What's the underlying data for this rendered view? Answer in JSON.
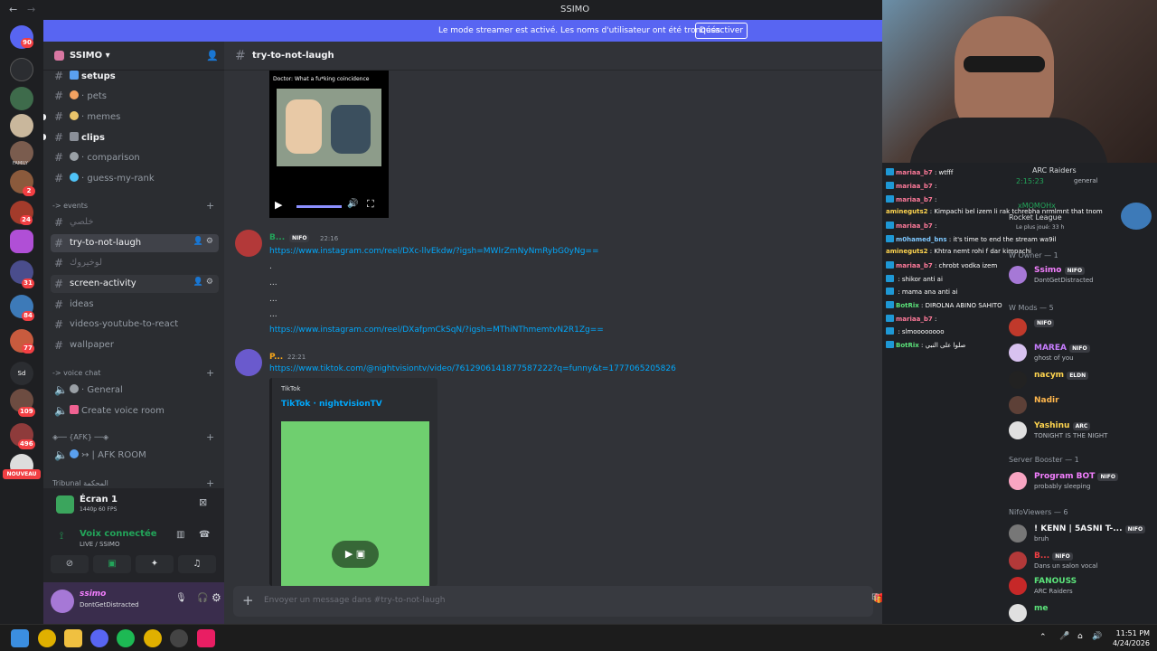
{
  "titlebar": {
    "back": "←",
    "forward": "→",
    "title": "SSIMO"
  },
  "banner": {
    "text": "Le mode streamer est activé. Les noms d'utilisateur ont été tronqués.",
    "button": "Désactiver"
  },
  "rail": {
    "badges": [
      "90",
      "2",
      "24",
      "31",
      "84",
      "77",
      "109",
      "496"
    ],
    "family_label": "FAMILY",
    "nouveau": "NOUVEAU"
  },
  "guild": {
    "name": "SSIMO"
  },
  "channels": [
    {
      "label": "setups",
      "bold": true,
      "hash": "#"
    },
    {
      "label": "· pets",
      "hash": "#"
    },
    {
      "label": "· memes",
      "hash": "#"
    },
    {
      "label": "clips",
      "bold": true,
      "hash": "#"
    },
    {
      "label": "· comparison",
      "hash": "#"
    },
    {
      "label": "· guess-my-rank",
      "hash": "#"
    }
  ],
  "categories": {
    "events": "-> events",
    "voice": "-> voice chat",
    "afk": "◈── {AFK} ──◈",
    "tribunal": "Tribunal المحكمة"
  },
  "events_channels": [
    {
      "label": "خلصي"
    },
    {
      "label": "try-to-not-laugh"
    },
    {
      "label": "لوخيروك"
    },
    {
      "label": "screen-activity"
    },
    {
      "label": "ideas"
    },
    {
      "label": "videos-youtube-to-react"
    },
    {
      "label": "wallpaper"
    }
  ],
  "voice_channels": [
    {
      "label": "· General"
    },
    {
      "label": "Create voice room"
    },
    {
      "label": "↣ | AFK ROOM"
    }
  ],
  "screen_share": {
    "title": "Écran 1",
    "quality": "1440p 60 FPS"
  },
  "voice": {
    "status": "Voix connectée",
    "sub": "LIVE / SSIMO"
  },
  "user": {
    "name": "ssimo",
    "status": "DontGetDistracted"
  },
  "chat": {
    "channel": "try-to-not-laugh",
    "meme_caption": "Doctor: What a fu*king coincidence",
    "messages": [
      {
        "author": "B...",
        "tag": "NIFO",
        "time": "22:16",
        "lines": [
          "https://www.instagram.com/reel/DXc-llvEkdw/?igsh=MWlrZmNyNmRybG0yNg==",
          ".",
          "...",
          "...",
          "...",
          "https://www.instagram.com/reel/DXafpmCkSqN/?igsh=MThiNThmemtvN2R1Zg=="
        ]
      },
      {
        "author": "P...",
        "time": "22:21",
        "lines": [
          "https://www.tiktok.com/@nightvisiontv/video/7612906141877587222?q=funny&t=1777065205826"
        ],
        "embed_provider": "TikTok",
        "embed_title": "TikTok · nightvisionTV"
      }
    ],
    "placeholder": "Envoyer un message dans #try-to-not-laugh"
  },
  "overlay": {
    "chat_lines": [
      {
        "user": "mariaa_b7",
        "text": ": wtfff",
        "color": "#ff7a9a"
      },
      {
        "user": "mariaa_b7",
        "text": ":",
        "color": "#ff7a9a"
      },
      {
        "user": "mariaa_b7",
        "text": ":",
        "color": "#ff7a9a"
      },
      {
        "user": "amineguts2",
        "text": ": Kimpachi bel izem li rak tchrebha nrmlmnt that tnom",
        "color": "#ffd54f"
      },
      {
        "user": "mariaa_b7",
        "text": ":",
        "color": "#ff7a9a"
      },
      {
        "user": "m0hamed_bns",
        "text": ": it's time to end the stream wa9il",
        "color": "#7ec8ff"
      },
      {
        "user": "amineguts2",
        "text": ": Khtra nemt rohi f dar kimpachi",
        "color": "#ffd54f"
      },
      {
        "user": "mariaa_b7",
        "text": ": chrobt vodka izem",
        "color": "#ff7a9a"
      },
      {
        "user": "",
        "text": ": shikor anti ai",
        "color": "#f23f43"
      },
      {
        "user": "",
        "text": ": mama ana anti ai",
        "color": "#f23f43"
      },
      {
        "user": "BotRix",
        "text": ": DIROLNA ABINO SAHITO",
        "color": "#5be37a"
      },
      {
        "user": "mariaa_b7",
        "text": ":",
        "color": "#ff7a9a"
      },
      {
        "user": "",
        "text": ": slmoooooooo",
        "color": "#f23f43"
      },
      {
        "user": "BotRix",
        "text": ": صلوا على النبي",
        "color": "#5be37a"
      }
    ],
    "activity": {
      "title": "ARC Raiders",
      "time": "2:15:23",
      "channel": "general"
    },
    "rl": {
      "user": "xMOMOHx",
      "game": "Rocket League",
      "played": "Le plus joué: 33 h"
    },
    "sections": {
      "owner": "W Owner — 1",
      "mods": "W Mods — 5",
      "booster": "Server Booster — 1",
      "viewers": "NifoViewers — 6"
    },
    "members": [
      {
        "name": "Ssimo",
        "tag": "NIFO",
        "status": "DontGetDistracted",
        "color": "#f47fff"
      },
      {
        "name": "",
        "tag": "NIFO",
        "status": "",
        "color": "#f23f43"
      },
      {
        "name": "MAREA",
        "tag": "NIFO",
        "status": "ghost of you",
        "color": "#c77dff"
      },
      {
        "name": "nacym",
        "tag": "ELDN",
        "status": "",
        "color": "#ffd54f"
      },
      {
        "name": "Nadir",
        "tag": "",
        "status": "",
        "color": "#ffb74d"
      },
      {
        "name": "Yashinu",
        "tag": "ARC",
        "status": "TONIGHT IS THE NIGHT",
        "color": "#ffd54f"
      },
      {
        "name": "Program BOT",
        "tag": "NIFO",
        "status": "probably sleeping",
        "color": "#f47fff"
      },
      {
        "name": "! KENN | 5ASNI T-...",
        "tag": "NIFO",
        "status": "bruh",
        "color": "#f2f3f5"
      },
      {
        "name": "B...",
        "tag": "NIFO",
        "status": "Dans un salon vocal",
        "color": "#f23f43"
      },
      {
        "name": "FANOUSS",
        "tag": "",
        "status": "ARC Raiders",
        "color": "#5be37a"
      },
      {
        "name": "me",
        "tag": "",
        "status": "",
        "color": "#5be37a"
      }
    ]
  },
  "taskbar": {
    "time": "11:51 PM",
    "date": "4/24/2026"
  }
}
